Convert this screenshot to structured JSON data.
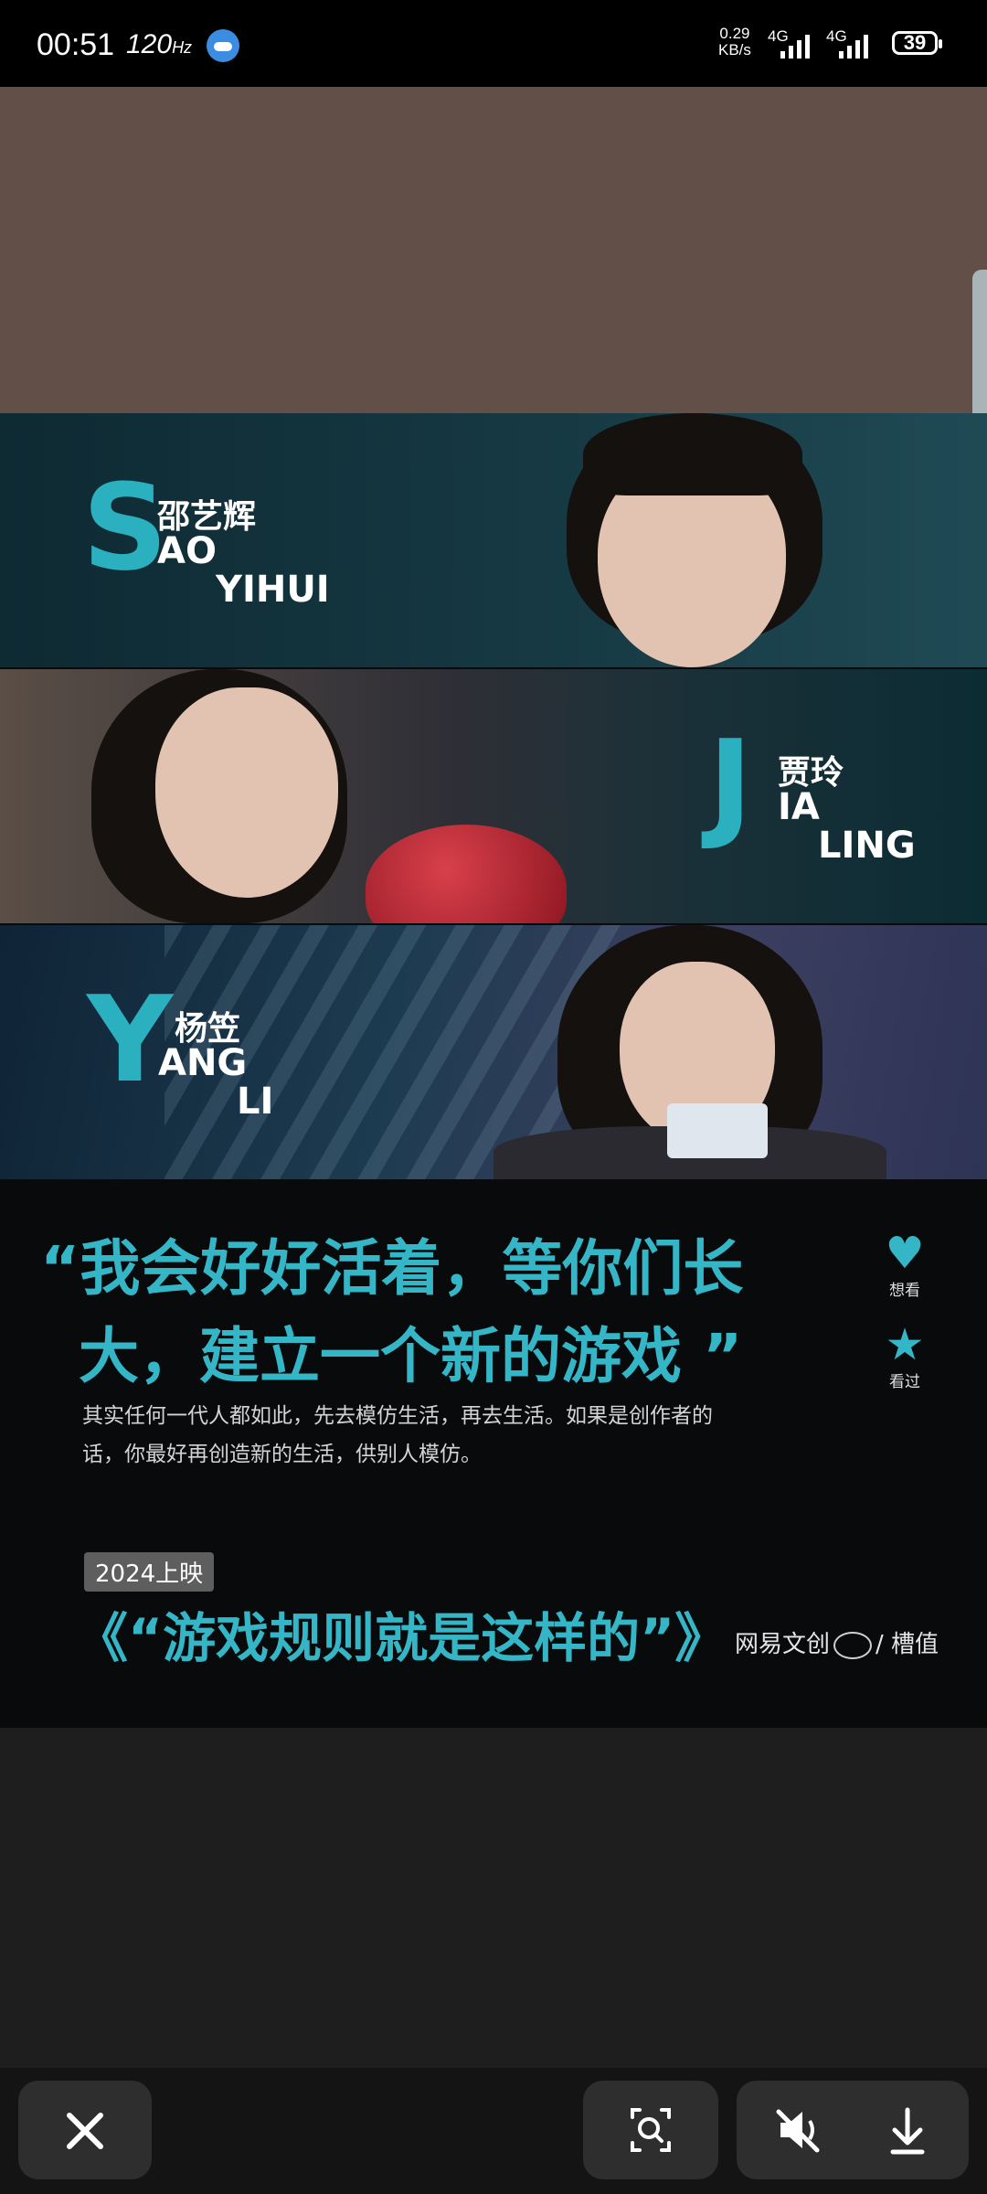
{
  "status_bar": {
    "time": "00:51",
    "refresh_rate": "120",
    "refresh_unit": "Hz",
    "net_speed_value": "0.29",
    "net_speed_unit": "KB/s",
    "signal_1": "4G",
    "signal_2": "4G",
    "battery": "39"
  },
  "poster": {
    "persons": [
      {
        "initial": "S",
        "chinese_name": "邵艺辉",
        "line1": "AO",
        "line2": "YIHUI"
      },
      {
        "initial": "J",
        "chinese_name": "贾玲",
        "line1": "IA",
        "line2": "LING"
      },
      {
        "initial": "Y",
        "chinese_name": "杨笠",
        "line1": "ANG",
        "line2": "LI"
      }
    ],
    "quote_line1": "“我会好好活着，等你们长",
    "quote_line2": "大，建立一个新的游戏 ”",
    "description_line1": "其实任何一代人都如此，先去模仿生活，再去生活。如果是创作者的",
    "description_line2": "话，你最好再创造新的生活，供别人模仿。",
    "release_badge": "2024上映",
    "movie_title": "《“游戏规则就是这样的”》",
    "producer_left": "网易文创",
    "producer_sep": "/",
    "producer_right": "槽值",
    "side_actions": [
      {
        "icon": "heart-icon",
        "label": "想看"
      },
      {
        "icon": "star-icon",
        "label": "看过"
      }
    ]
  },
  "bottom_bar": {
    "close_icon": "close-icon",
    "scan_icon": "image-search-icon",
    "mute_icon": "speaker-muted-icon",
    "download_icon": "download-icon"
  },
  "colors": {
    "accent": "#35b6c6",
    "brown_area": "#624f48",
    "bottom_button": "#2e2e2e"
  }
}
